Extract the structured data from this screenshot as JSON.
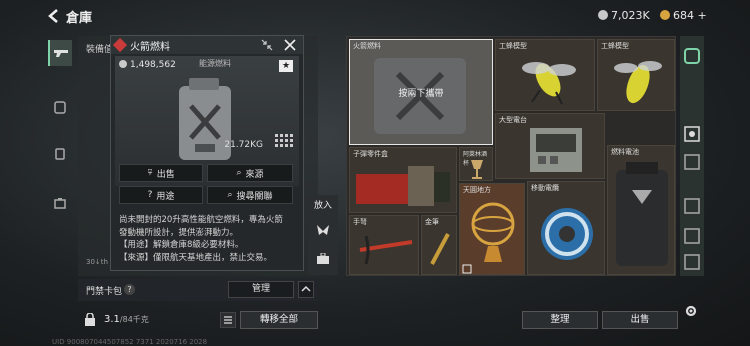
{
  "topbar": {
    "title": "倉庫",
    "currency1": "7,023K",
    "currency2": "684",
    "currency2_plus": "+"
  },
  "left_panel": {
    "label": "裝備值",
    "side_label": "30↓th"
  },
  "popup": {
    "title": "火箭燃料",
    "price": "1,498,562",
    "category": "能源燃料",
    "star": "★",
    "weight": "21.72KG",
    "actions": [
      {
        "label": "出售",
        "icon": "sell-icon"
      },
      {
        "label": "來源",
        "icon": "search-icon"
      },
      {
        "label": "用途",
        "icon": "question-icon"
      },
      {
        "label": "搜尋關聯",
        "icon": "search-icon"
      }
    ],
    "desc": [
      "尚未開封的20升高性能航空燃料，專為火箭",
      "發動機所設計，提供澎湃動力。",
      "【用途】解鎖倉庫8級必要材料。",
      "【來源】僅限航天基地產出，禁止交易。"
    ]
  },
  "put_panel": {
    "label": "放入"
  },
  "bottom_left": {
    "keycard_label": "門禁卡包",
    "help": "?",
    "manage_label": "管理",
    "capacity": "3.1",
    "capacity_max": "/84千克",
    "move_all_label": "轉移全部",
    "uid": "UID 900807044507852 7371 2020716 2028"
  },
  "warehouse": {
    "slots": [
      {
        "label": "火箭燃料",
        "drag_hint": "按兩下攜帶"
      },
      {
        "label": "工蜂模型"
      },
      {
        "label": "工蜂模型"
      },
      {
        "label": "大型電台"
      },
      {
        "label": "燃料電池"
      },
      {
        "label": "子彈零件盒"
      },
      {
        "label": "阿萊林酒杯"
      },
      {
        "label": "天圓地方"
      },
      {
        "label": "移動電纜"
      },
      {
        "label": "手弩"
      },
      {
        "label": "金筆"
      }
    ],
    "sort_label": "整理",
    "sell_label": "出售"
  },
  "colors": {
    "accent": "#7ed3a8",
    "danger": "#c93b3b",
    "gold": "#d8a440"
  }
}
